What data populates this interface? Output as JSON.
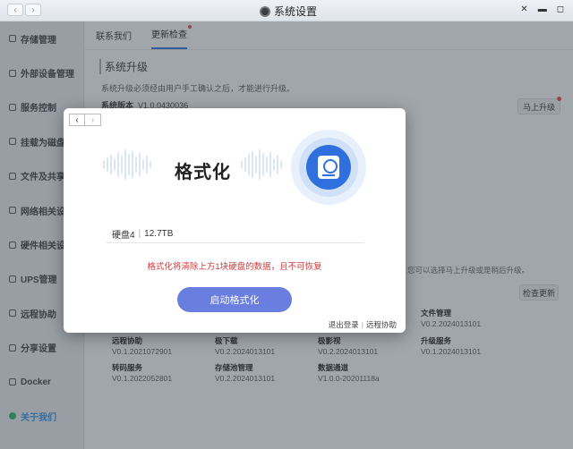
{
  "window": {
    "title": "系统设置"
  },
  "sidebar": {
    "items": [
      {
        "label": "存储管理"
      },
      {
        "label": "外部设备管理"
      },
      {
        "label": "服务控制"
      },
      {
        "label": "挂载为磁盘"
      },
      {
        "label": "文件及共享"
      },
      {
        "label": "网络相关设置"
      },
      {
        "label": "硬件相关设置"
      },
      {
        "label": "UPS管理"
      },
      {
        "label": "远程协助"
      },
      {
        "label": "分享设置"
      },
      {
        "label": "Docker"
      },
      {
        "label": "关于我们"
      }
    ]
  },
  "main": {
    "tabs": [
      {
        "label": "联系我们"
      },
      {
        "label": "更新检查"
      }
    ],
    "section_title": "系统升级",
    "notice": "系统升级必须经由用户手工确认之后，才能进行升级。",
    "system_version_label": "系统版本",
    "system_version_value": "V1.0.0430036",
    "upgrade_button": "马上升级",
    "hint": "您可以选择马上升级或是稍后升级。",
    "check_button": "检查更新",
    "services": [
      {
        "name": "文件管理",
        "version": "V0.2.2024013101"
      },
      {
        "name": "远程协助",
        "version": "V0.1.2021072901"
      },
      {
        "name": "极下载",
        "version": "V0.2.2024013101"
      },
      {
        "name": "极影视",
        "version": "V0.2.2024013101"
      },
      {
        "name": "升级服务",
        "version": "V0.1.2024013101"
      },
      {
        "name": "转码服务",
        "version": "V0.1.2022052801"
      },
      {
        "name": "存储池管理",
        "version": "V0.2.2024013101"
      },
      {
        "name": "数据通道",
        "version": "V1.0.0-20201118a"
      }
    ]
  },
  "modal": {
    "title": "格式化",
    "disk_name": "硬盘4",
    "disk_size": "12.7TB",
    "warning": "格式化将清除上方1块硬盘的数据，且不可恢复",
    "format_button": "启动格式化",
    "logout_link": "退出登录",
    "remote_assist_link": "远程协助",
    "icon": "hard-disk-icon"
  },
  "colors": {
    "accent": "#2f6fde",
    "button": "#6a7ee0",
    "warning": "#d23c3c",
    "active_nav": "#2f8fe0"
  }
}
